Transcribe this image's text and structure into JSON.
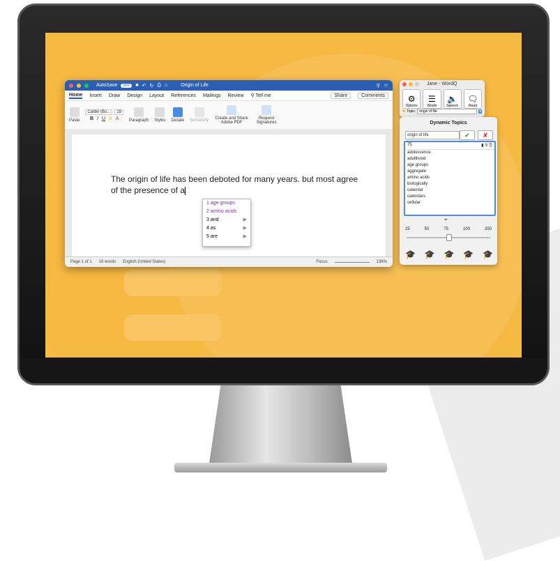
{
  "word": {
    "title": "Origin of Life",
    "autosave_label": "AutoSave",
    "autosave_state": "OFF",
    "menu": [
      "Home",
      "Insert",
      "Draw",
      "Design",
      "Layout",
      "References",
      "Mailings",
      "Review",
      "Tell me"
    ],
    "share_label": "Share",
    "comments_label": "Comments",
    "ribbon": {
      "paste": "Paste",
      "font": "Calibri (Bo...",
      "size": "18",
      "paragraph": "Paragraph",
      "styles": "Styles",
      "dictate": "Dictate",
      "sensitivity": "Sensitivity",
      "create_share": "Create and Share Adobe PDF",
      "request_sigs": "Request Signatures"
    },
    "doc_text": "The origin of life has been deboted for many years. but most agree of the presence of a",
    "status": {
      "page": "Page 1 of 1",
      "words": "18 words",
      "language": "English (United States)",
      "focus": "Focus",
      "zoom": "136%"
    }
  },
  "prediction": [
    {
      "num": "1",
      "label": "age groups",
      "style": "purple",
      "arrow": ""
    },
    {
      "num": "2",
      "label": "amino acids",
      "style": "purple",
      "arrow": ""
    },
    {
      "num": "3",
      "label": "and",
      "style": "",
      "arrow": "▶"
    },
    {
      "num": "4",
      "label": "as",
      "style": "",
      "arrow": "▶"
    },
    {
      "num": "5",
      "label": "are",
      "style": "",
      "arrow": "▶"
    }
  ],
  "wordq": {
    "title": "Jane - WordQ",
    "buttons": [
      "Options",
      "Words",
      "Speech",
      "Read"
    ],
    "topic_label": "Topic:",
    "topic_value": "origin of life"
  },
  "dynamic_topics": {
    "header": "Dynamic Topics",
    "input_value": "origin of life",
    "count": "75",
    "items": [
      "adolescence",
      "adulthood",
      "age groups",
      "aggregate",
      "amino acids",
      "biologically",
      "calendar",
      "calendars",
      "cellular"
    ],
    "scale": [
      "25",
      "50",
      "75",
      "100",
      "200"
    ],
    "slider_value": 75
  },
  "colors": {
    "screen": "#f6b941",
    "titlebar": "#2b5fb4",
    "highlight": "#4a8be5",
    "suggest": "#7b2fbe"
  }
}
